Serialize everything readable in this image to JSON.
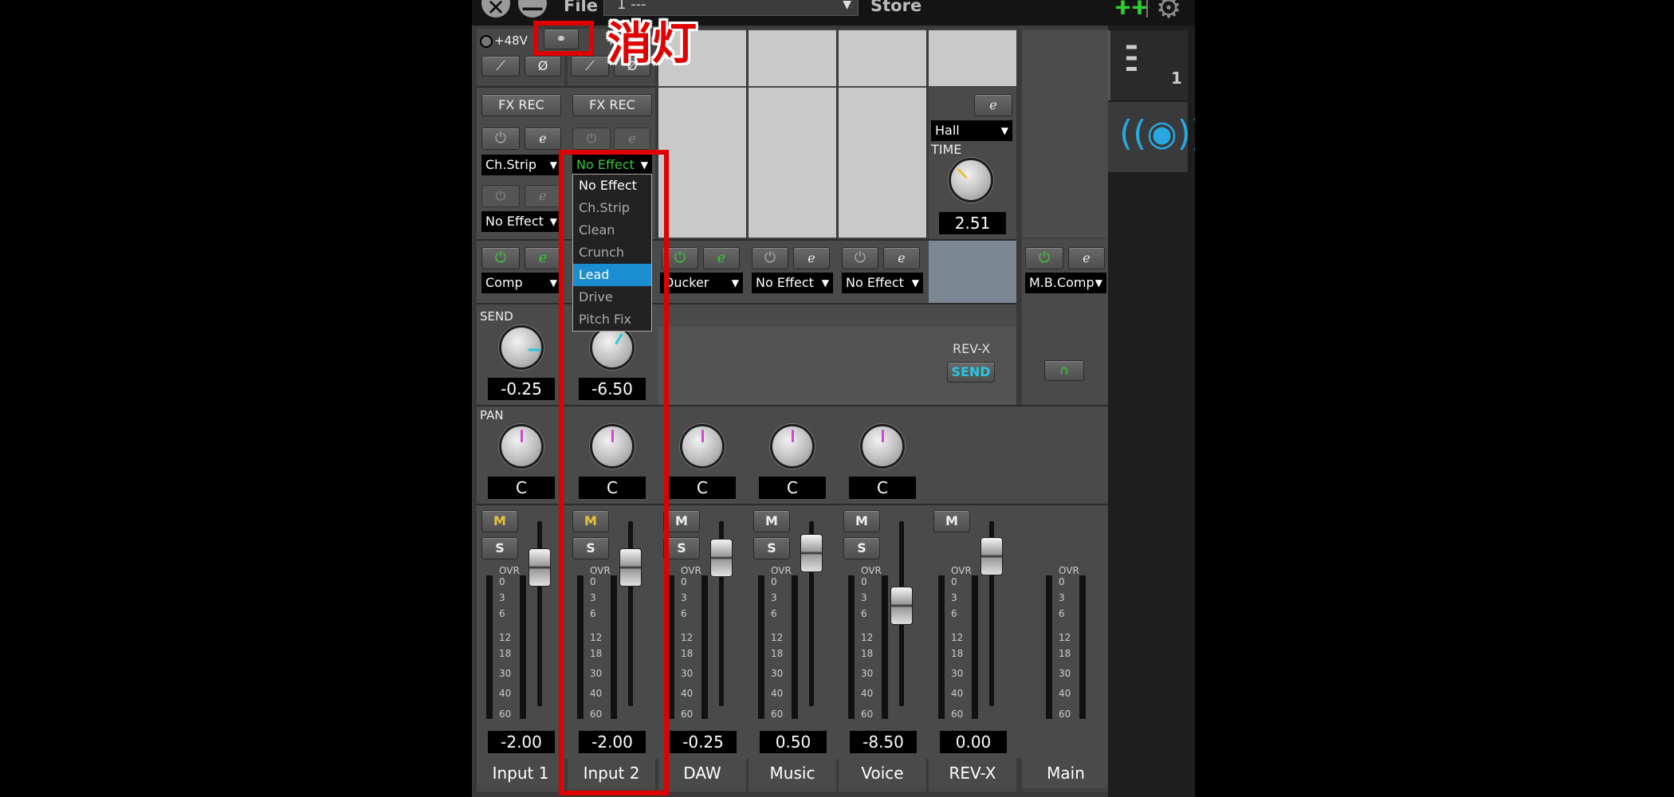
{
  "titlebar": {
    "file_label": "File",
    "preset_value": "1  ---",
    "store_label": "Store"
  },
  "annotation": {
    "text": "消灯"
  },
  "header": {
    "phantom_label": "+48V",
    "phantom_label_2": "+"
  },
  "fx_rec_label": "FX REC",
  "send_label": "SEND",
  "pan_label": "PAN",
  "reverb": {
    "type": "Hall",
    "param_label": "TIME",
    "param_value": "2.51",
    "send_title": "REV-X",
    "send_button": "SEND"
  },
  "dropdown": {
    "items": [
      "No Effect",
      "Ch.Strip",
      "Clean",
      "Crunch",
      "Lead",
      "Drive",
      "Pitch Fix"
    ],
    "selected": "Lead"
  },
  "meter_scale": [
    "OVR",
    "0",
    "3",
    "6",
    "12",
    "18",
    "30",
    "40",
    "60"
  ],
  "channels": [
    {
      "name": "Input 1",
      "ins1": "Ch.Strip",
      "ins2": "No Effect",
      "dyn": "Comp",
      "send": "-0.25",
      "pan": "C",
      "fader": "-2.00",
      "mute": "M",
      "solo": "S"
    },
    {
      "name": "Input 2",
      "ins1": "No Effect",
      "dyn": "",
      "send": "-6.50",
      "pan": "C",
      "fader": "-2.00",
      "mute": "M",
      "solo": "S"
    },
    {
      "name": "DAW",
      "dyn": "Ducker",
      "pan": "C",
      "fader": "-0.25",
      "mute": "M",
      "solo": "S"
    },
    {
      "name": "Music",
      "dyn": "No Effect",
      "pan": "C",
      "fader": "0.50",
      "mute": "M",
      "solo": "S"
    },
    {
      "name": "Voice",
      "dyn": "No Effect",
      "pan": "C",
      "fader": "-8.50",
      "mute": "M",
      "solo": "S"
    },
    {
      "name": "REV-X",
      "fader": "0.00",
      "mute": "M"
    },
    {
      "name": "Main",
      "dyn": "M.B.Comp"
    }
  ],
  "right_panel": {
    "mixer_tab_number": "1"
  },
  "colors": {
    "annotation_red": "#e00000",
    "selected_blue": "#1a8ed0",
    "power_green": "#3ec43e",
    "mute_yellow": "#e8c23a",
    "pan_magenta": "#d048d0",
    "send_cyan": "#28c8e0"
  }
}
